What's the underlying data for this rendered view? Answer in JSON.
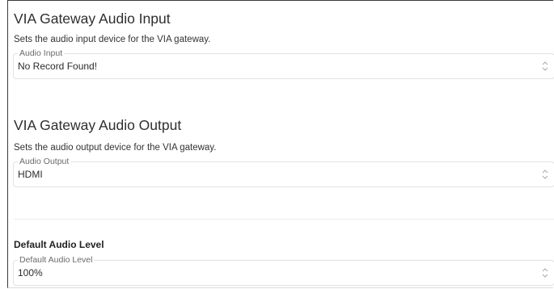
{
  "audio_input": {
    "title": "VIA Gateway Audio Input",
    "description": "Sets the audio input device for the VIA gateway.",
    "field_label": "Audio Input",
    "value": "No Record Found!"
  },
  "audio_output": {
    "title": "VIA Gateway Audio Output",
    "description": "Sets the audio output device for the VIA gateway.",
    "field_label": "Audio Output",
    "value": "HDMI"
  },
  "default_audio_level": {
    "title": "Default Audio Level",
    "field_label": "Default Audio Level",
    "value": "100%"
  },
  "colors": {
    "border": "#e2e2e2",
    "label": "#6a6a6a",
    "text": "#2b2b2b"
  },
  "icons": {
    "select_arrow": "chevron-up-down-icon"
  }
}
